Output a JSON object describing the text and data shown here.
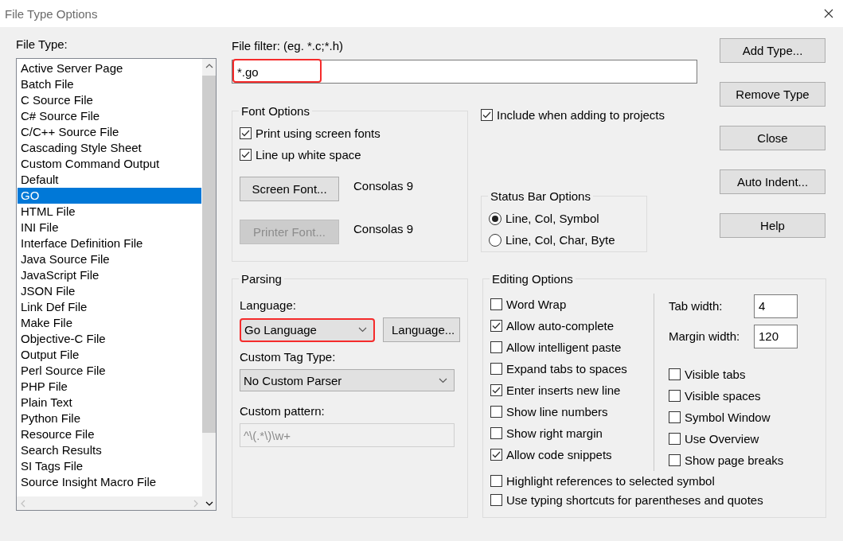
{
  "window": {
    "title": "File Type Options"
  },
  "file_type": {
    "label": "File Type:",
    "items": [
      {
        "label": "Active Server Page",
        "selected": false
      },
      {
        "label": "Batch File",
        "selected": false
      },
      {
        "label": "C Source File",
        "selected": false
      },
      {
        "label": "C# Source File",
        "selected": false
      },
      {
        "label": "C/C++ Source File",
        "selected": false
      },
      {
        "label": "Cascading Style Sheet",
        "selected": false
      },
      {
        "label": "Custom Command Output",
        "selected": false
      },
      {
        "label": "Default",
        "selected": false
      },
      {
        "label": "GO",
        "selected": true
      },
      {
        "label": "HTML File",
        "selected": false
      },
      {
        "label": "INI File",
        "selected": false
      },
      {
        "label": "Interface Definition File",
        "selected": false
      },
      {
        "label": "Java Source File",
        "selected": false
      },
      {
        "label": "JavaScript File",
        "selected": false
      },
      {
        "label": "JSON File",
        "selected": false
      },
      {
        "label": "Link Def File",
        "selected": false
      },
      {
        "label": "Make File",
        "selected": false
      },
      {
        "label": "Objective-C File",
        "selected": false
      },
      {
        "label": "Output File",
        "selected": false
      },
      {
        "label": "Perl Source File",
        "selected": false
      },
      {
        "label": "PHP File",
        "selected": false
      },
      {
        "label": "Plain Text",
        "selected": false
      },
      {
        "label": "Python File",
        "selected": false
      },
      {
        "label": "Resource File",
        "selected": false
      },
      {
        "label": "Search Results",
        "selected": false
      },
      {
        "label": "SI Tags File",
        "selected": false
      },
      {
        "label": "Source Insight Macro File",
        "selected": false
      }
    ]
  },
  "file_filter": {
    "label": "File filter: (eg. *.c;*.h)",
    "value": "*.go",
    "highlighted": true
  },
  "font_options": {
    "title": "Font Options",
    "checkboxes": [
      {
        "label": "Print using screen fonts",
        "checked": true
      },
      {
        "label": "Line up white space",
        "checked": true
      }
    ],
    "fonts": [
      {
        "button": "Screen Font...",
        "disabled": false,
        "value": "Consolas 9"
      },
      {
        "button": "Printer Font...",
        "disabled": true,
        "value": "Consolas 9"
      }
    ]
  },
  "include_in_projects": {
    "label": "Include when adding to projects",
    "checked": true
  },
  "status_bar_options": {
    "title": "Status Bar Options",
    "options": [
      {
        "label": "Line, Col, Symbol",
        "selected": true
      },
      {
        "label": "Line, Col, Char, Byte",
        "selected": false
      }
    ]
  },
  "buttons": [
    "Add Type...",
    "Remove Type",
    "Close",
    "Auto Indent...",
    "Help"
  ],
  "parsing": {
    "title": "Parsing",
    "language": {
      "label": "Language:",
      "value": "Go Language",
      "highlighted": true
    },
    "language_button": "Language...",
    "custom_tag_type": {
      "label": "Custom Tag Type:",
      "value": "No Custom Parser",
      "highlighted": false
    },
    "custom_pattern": {
      "label": "Custom pattern:",
      "value": "^\\(.*\\)\\w+",
      "disabled": true
    }
  },
  "editing_options": {
    "title": "Editing Options",
    "left_checkboxes": [
      {
        "label": "Word Wrap",
        "checked": false
      },
      {
        "label": "Allow auto-complete",
        "checked": true
      },
      {
        "label": "Allow intelligent paste",
        "checked": false
      },
      {
        "label": "Expand tabs to spaces",
        "checked": false
      },
      {
        "label": "Enter inserts new line",
        "checked": true
      },
      {
        "label": "Show line numbers",
        "checked": false
      },
      {
        "label": "Show right margin",
        "checked": false
      },
      {
        "label": "Allow code snippets",
        "checked": true
      }
    ],
    "tab_width": {
      "label": "Tab width:",
      "value": "4"
    },
    "margin_width": {
      "label": "Margin width:",
      "value": "120"
    },
    "right_checkboxes": [
      {
        "label": "Visible tabs",
        "checked": false
      },
      {
        "label": "Visible spaces",
        "checked": false
      },
      {
        "label": "Symbol Window",
        "checked": false
      },
      {
        "label": "Use Overview",
        "checked": false
      },
      {
        "label": "Show page breaks",
        "checked": false
      }
    ],
    "bottom_checkboxes": [
      {
        "label": "Highlight references to selected symbol",
        "checked": false
      },
      {
        "label": "Use typing shortcuts for parentheses and quotes",
        "checked": false
      }
    ]
  }
}
